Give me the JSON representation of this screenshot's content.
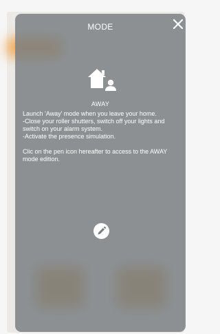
{
  "modal": {
    "title": "MODE",
    "close_icon": "close-icon",
    "mode_icon": "home-away-icon",
    "mode_name": "AWAY",
    "description": [
      "Launch 'Away' mode when you leave your home.\n-Close your roller shutters, switch off your lights and switch on your alarm system.\n-Activate the presence simulation.",
      "Clic on the pen icon hereafter to access to the AWAY mode edition."
    ],
    "edit_icon": "pen-icon"
  },
  "colors": {
    "overlay": "#767c80",
    "text": "#ffffff",
    "accent": "#f0a04a"
  }
}
